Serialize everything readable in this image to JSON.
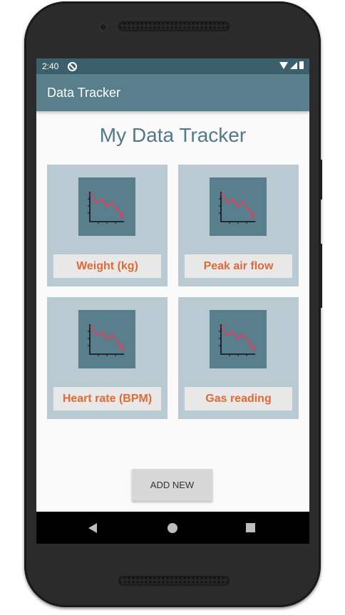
{
  "status_bar": {
    "time": "2:40",
    "icons": [
      "do-not-disturb-icon",
      "wifi-icon",
      "signal-icon",
      "battery-icon"
    ]
  },
  "app_bar": {
    "title": "Data Tracker"
  },
  "main": {
    "title": "My Data Tracker",
    "tiles": [
      {
        "label": "Weight (kg)",
        "icon": "chart-icon"
      },
      {
        "label": "Peak air flow",
        "icon": "chart-icon"
      },
      {
        "label": "Heart rate (BPM)",
        "icon": "chart-icon"
      },
      {
        "label": "Gas reading",
        "icon": "chart-icon"
      }
    ],
    "add_button_label": "ADD NEW"
  },
  "nav_bar": {
    "icons": [
      "back-icon",
      "home-icon",
      "recents-icon"
    ]
  },
  "colors": {
    "status_bar": "#3c5f6c",
    "app_bar": "#5a7f8c",
    "title_text": "#53788a",
    "tile_bg": "#b9cad2",
    "tile_label_text": "#e06a36",
    "chart_line": "#e53d5a"
  }
}
